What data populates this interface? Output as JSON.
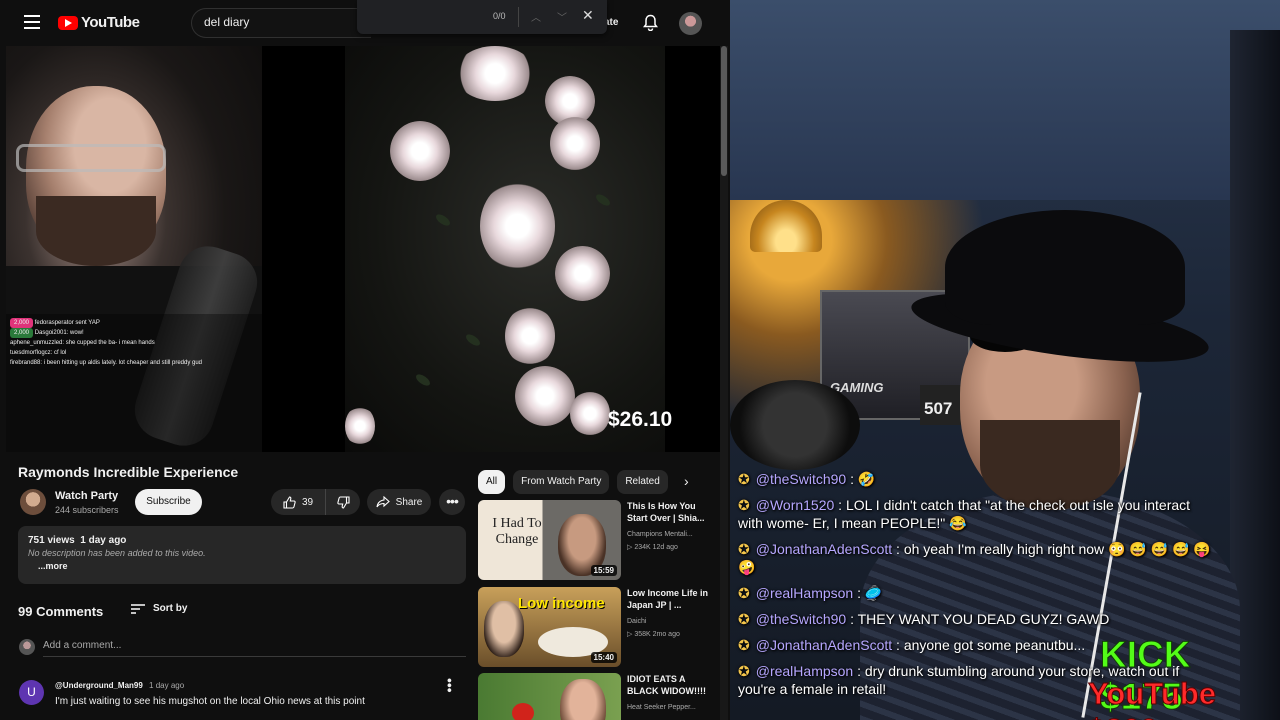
{
  "header": {
    "logo_text": "YouTube",
    "search_value": "del diary",
    "find_count": "0/0",
    "create_label": "ate"
  },
  "player": {
    "price_overlay": "$26.10",
    "overlay_chat": [
      {
        "badge": "2,000",
        "text": "fedorasperator sent YAP"
      },
      {
        "badge": "2,000",
        "text": "Dasgoi2001: wow!"
      },
      {
        "badge": "",
        "text": "aphene_unmuzzled: she cupped the ba- i mean hands"
      },
      {
        "badge": "",
        "text": "tuesdmorflogcz: cf lol"
      },
      {
        "badge": "",
        "text": "firebrand88: i been hitting up aldis lately. lot cheaper and still preddy gud"
      }
    ]
  },
  "video": {
    "title": "Raymonds Incredible Experience",
    "channel_name": "Watch Party",
    "subscribers": "244 subscribers",
    "subscribe_label": "Subscribe",
    "like_count": "39",
    "share_label": "Share"
  },
  "description": {
    "views": "751 views",
    "age": "1 day ago",
    "text": "No description has been added to this video.",
    "more_label": "...more"
  },
  "comments": {
    "count_label": "99 Comments",
    "sort_label": "Sort by",
    "add_placeholder": "Add a comment...",
    "items": [
      {
        "avatar_letter": "U",
        "author": "@Underground_Man99",
        "ago": "1 day ago",
        "text": "I'm just waiting to see his mugshot on the local Ohio news at this point"
      }
    ]
  },
  "related": {
    "chips": [
      "All",
      "From Watch Party",
      "Related"
    ],
    "items": [
      {
        "thumb_text": "I Had To Change",
        "duration": "15:59",
        "title": "This Is How You Start Over | Shia...",
        "channel": "Champions Mentali...",
        "stats": "▷ 234K  12d ago"
      },
      {
        "thumb_text": "Low income",
        "duration": "15:40",
        "title": "Low Income Life in Japan JP | ...",
        "channel": "Daichi",
        "stats": "▷ 358K  2mo ago"
      },
      {
        "thumb_text": "",
        "duration": "",
        "title": "IDIOT EATS A BLACK WIDOW!!!!",
        "channel": "Heat Seeker Pepper...",
        "stats": ""
      }
    ]
  },
  "webcam": {
    "pc_text": "GAMING",
    "gpu_text": "507"
  },
  "stream_chat": [
    {
      "name": "@theSwitch90",
      "text": ": 🤣"
    },
    {
      "name": "@Worn1520",
      "text": ": LOL I didn't catch that \"at the check out isle you interact with wome- Er, I mean PEOPLE!\" 😂"
    },
    {
      "name": "@JonathanAdenScott",
      "text": ": oh yeah I'm really high right now 😳 😅 😅 😅 😝 🤪"
    },
    {
      "name": "@realHampson",
      "text": ": 🥏"
    },
    {
      "name": "@theSwitch90",
      "text": ": THEY WANT YOU DEAD GUYZ! GAWD"
    },
    {
      "name": "@JonathanAdenScott",
      "text": ": anyone got some peanutbu..."
    },
    {
      "name": "@realHampson",
      "text": ": dry drunk stumbling around your store, watch out if you're a female in retail!"
    }
  ],
  "donations": {
    "kick": "KICK $175",
    "youtube": "YouTube $266"
  }
}
